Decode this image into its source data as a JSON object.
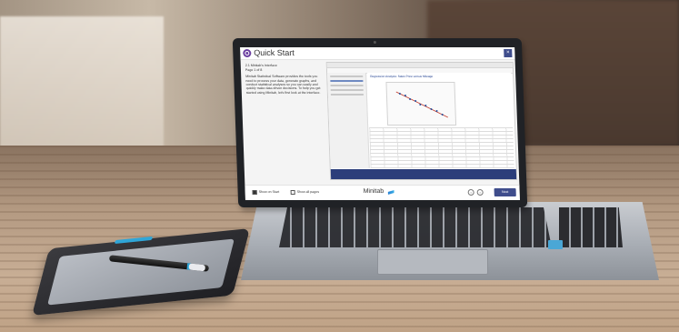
{
  "quick_start": {
    "title": "Quick Start",
    "section": "2.1 Minitab's Interface",
    "page": "Page 1 of 8",
    "body": "Minitab Statistical Software provides the tools you need to process your data, generate graphs, and conduct statistical analyses so you can easily and quickly make data driven decisions. To help you get started using Minitab, let's first look at the interface.",
    "show_on_startup_label": "Show on Start",
    "show_all_label": "Show all pages",
    "brand": "Minitab",
    "next_label": "Next"
  },
  "embedded_output": {
    "heading": "Regression Analysis: Sales Price versus Mileage"
  },
  "colors": {
    "accent_purple": "#6b3fa0",
    "minitab_blue": "#3f4d8c",
    "tablet_accent": "#2fa6d8"
  },
  "icons": {
    "logo": "quick-start-logo-icon",
    "close": "close-icon",
    "prev": "chevron-left-icon",
    "next": "chevron-right-icon"
  }
}
